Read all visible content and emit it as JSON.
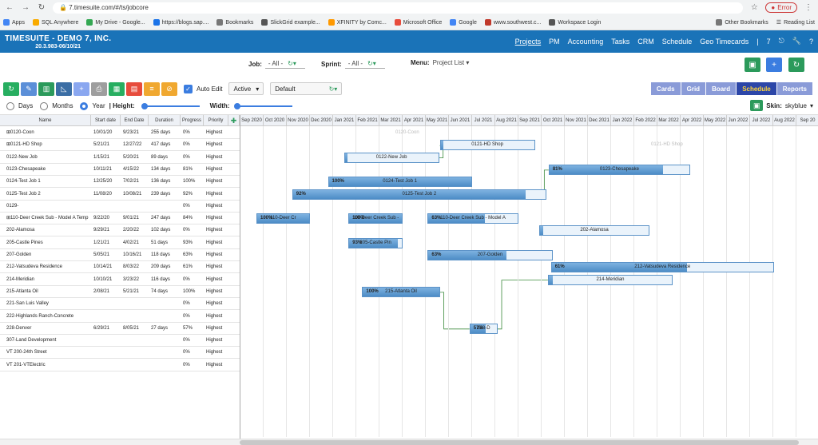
{
  "browser": {
    "url": "7.timesuite.com/#/ts/jobcore",
    "error_label": "Error",
    "bookmarks": [
      "Apps",
      "SQL Anywhere",
      "My Drive - Google...",
      "https://blogs.sap....",
      "Bookmarks",
      "SlickGrid example...",
      "XFINITY by Comc...",
      "Microsoft Office",
      "Google",
      "www.southwest.c...",
      "Workspace Login"
    ],
    "other_bookmarks": "Other Bookmarks",
    "reading_list": "Reading List"
  },
  "app": {
    "title": "TIMESUITE - DEMO 7, INC.",
    "version": "20.3.983-06/10/21",
    "menu": [
      "Projects",
      "PM",
      "Accounting",
      "Tasks",
      "CRM",
      "Schedule",
      "Geo Timecards"
    ],
    "menu_count": "7"
  },
  "filters": {
    "job_label": "Job:",
    "job_value": "- All -",
    "sprint_label": "Sprint:",
    "sprint_value": "- All -",
    "menu_label": "Menu:",
    "menu_value": "Project List"
  },
  "toolbar": {
    "auto_edit": "Auto Edit",
    "status": "Active",
    "view": "Default",
    "views": [
      "Cards",
      "Grid",
      "Board",
      "Schedule",
      "Reports"
    ],
    "active_view": "Schedule"
  },
  "scale": {
    "days": "Days",
    "months": "Months",
    "year": "Year",
    "height": "| Height:",
    "width": "Width:",
    "skin_label": "Skin:",
    "skin_value": "skyblue"
  },
  "columns": [
    "Name",
    "Start date",
    "End Date",
    "Duration",
    "Progress",
    "Priority"
  ],
  "months": [
    "Sep 2020",
    "Oct 2020",
    "Nov 2020",
    "Dec 2020",
    "Jan 2021",
    "Feb 2021",
    "Mar 2021",
    "Apr 2021",
    "May 2021",
    "Jun 2021",
    "Jul 2021",
    "Aug 2021",
    "Sep 2021",
    "Oct 2021",
    "Nov 2021",
    "Dec 2021",
    "Jan 2022",
    "Feb 2022",
    "Mar 2022",
    "Apr 2022",
    "May 2022",
    "Jun 2022",
    "Jul 2022",
    "Aug 2022",
    "Sep 20"
  ],
  "rows": [
    {
      "name": "⊞0120-Coon",
      "start": "10/01/20",
      "end": "9/23/21",
      "dur": "255 days",
      "prog": "0%",
      "pri": "Highest"
    },
    {
      "name": "⊞0121-HD Shop",
      "start": "5/21/21",
      "end": "12/27/22",
      "dur": "417 days",
      "prog": "0%",
      "pri": "Highest"
    },
    {
      "name": "0122-New Job",
      "start": "1/15/21",
      "end": "5/20/21",
      "dur": "89 days",
      "prog": "0%",
      "pri": "Highest"
    },
    {
      "name": "0123-Chesapeake",
      "start": "10/11/21",
      "end": "4/15/22",
      "dur": "134 days",
      "prog": "81%",
      "pri": "Highest"
    },
    {
      "name": "0124-Test Job 1",
      "start": "12/25/20",
      "end": "7/02/21",
      "dur": "136 days",
      "prog": "100%",
      "pri": "Highest"
    },
    {
      "name": "0125-Test Job 2",
      "start": "11/08/20",
      "end": "10/08/21",
      "dur": "239 days",
      "prog": "92%",
      "pri": "Highest"
    },
    {
      "name": "0129-",
      "start": "",
      "end": "",
      "dur": "",
      "prog": "0%",
      "pri": "Highest"
    },
    {
      "name": "⊞110-Deer Creek Sub - Model A Temp",
      "start": "9/22/20",
      "end": "9/01/21",
      "dur": "247 days",
      "prog": "84%",
      "pri": "Highest"
    },
    {
      "name": "202-Alamosa",
      "start": "9/29/21",
      "end": "2/20/22",
      "dur": "102 days",
      "prog": "0%",
      "pri": "Highest"
    },
    {
      "name": "205-Castle Pines",
      "start": "1/21/21",
      "end": "4/02/21",
      "dur": "51 days",
      "prog": "93%",
      "pri": "Highest"
    },
    {
      "name": "207-Golden",
      "start": "5/05/21",
      "end": "10/16/21",
      "dur": "118 days",
      "prog": "63%",
      "pri": "Highest"
    },
    {
      "name": "212-Vatsudeva Residence",
      "start": "10/14/21",
      "end": "8/03/22",
      "dur": "209 days",
      "prog": "61%",
      "pri": "Highest"
    },
    {
      "name": "214-Meridian",
      "start": "10/10/21",
      "end": "3/23/22",
      "dur": "116 days",
      "prog": "0%",
      "pri": "Highest"
    },
    {
      "name": "215-Atlanta Oil",
      "start": "2/08/21",
      "end": "5/21/21",
      "dur": "74 days",
      "prog": "100%",
      "pri": "Highest"
    },
    {
      "name": "221-San Luis Valley",
      "start": "",
      "end": "",
      "dur": "",
      "prog": "0%",
      "pri": "Highest"
    },
    {
      "name": "222-Highlands Ranch-Concrete",
      "start": "",
      "end": "",
      "dur": "",
      "prog": "0%",
      "pri": "Highest"
    },
    {
      "name": "228-Denver",
      "start": "6/29/21",
      "end": "8/05/21",
      "dur": "27 days",
      "prog": "57%",
      "pri": "Highest"
    },
    {
      "name": "307-Land Development",
      "start": "",
      "end": "",
      "dur": "",
      "prog": "0%",
      "pri": "Highest"
    },
    {
      "name": "VT 200-24th Street",
      "start": "",
      "end": "",
      "dur": "",
      "prog": "0%",
      "pri": "Highest"
    },
    {
      "name": "VT 201-VTElectric",
      "start": "",
      "end": "",
      "dur": "",
      "prog": "0%",
      "pri": "Highest"
    }
  ],
  "bars": [
    {
      "row": 1,
      "start": "2021-05-21",
      "end": "2021-09-23",
      "label": "0121-HD Shop",
      "pct": ""
    },
    {
      "row": 2,
      "start": "2021-01-15",
      "end": "2021-05-20",
      "label": "0122-New Job",
      "pct": ""
    },
    {
      "row": 3,
      "start": "2021-10-11",
      "end": "2022-04-15",
      "label": "0123-Chesapeake",
      "pct": "81%",
      "progress": 0.81
    },
    {
      "row": 4,
      "start": "2020-12-25",
      "end": "2021-07-02",
      "label": "0124-Test Job 1",
      "pct": "100%",
      "progress": 1
    },
    {
      "row": 5,
      "start": "2020-11-08",
      "end": "2021-10-08",
      "label": "0125-Test Job 2",
      "pct": "92%",
      "progress": 0.92
    },
    {
      "row": 7,
      "start": "2020-09-22",
      "end": "2020-12-01",
      "label": "110-Deer Cr",
      "pct": "100%",
      "progress": 1
    },
    {
      "row": 7,
      "start": "2021-01-21",
      "end": "2021-04-02",
      "label": "110-Deer Creek Sub -",
      "pct": "100%",
      "progress": 1
    },
    {
      "row": 7,
      "start": "2021-05-05",
      "end": "2021-09-01",
      "label": "110-Deer Creek Sub - Model A",
      "pct": "63%",
      "progress": 0.63
    },
    {
      "row": 8,
      "start": "2021-09-29",
      "end": "2022-02-20",
      "label": "202-Alamosa",
      "pct": ""
    },
    {
      "row": 9,
      "start": "2021-01-21",
      "end": "2021-04-02",
      "label": "205-Castle Pin",
      "pct": "93%",
      "progress": 0.93
    },
    {
      "row": 10,
      "start": "2021-05-05",
      "end": "2021-10-16",
      "label": "207-Golden",
      "pct": "63%",
      "progress": 0.63
    },
    {
      "row": 11,
      "start": "2021-10-14",
      "end": "2022-08-03",
      "label": "212-Vatsudeva Residence",
      "pct": "61%",
      "progress": 0.61
    },
    {
      "row": 12,
      "start": "2021-10-10",
      "end": "2022-03-23",
      "label": "214-Meridian",
      "pct": ""
    },
    {
      "row": 13,
      "start": "2021-02-08",
      "end": "2021-05-21",
      "label": "215-Atlanta Oil",
      "pct": "100%",
      "progress": 1
    },
    {
      "row": 16,
      "start": "2021-06-29",
      "end": "2021-08-05",
      "label": "228-D",
      "pct": "57%",
      "progress": 0.57
    }
  ],
  "ghosts": [
    {
      "row": 0,
      "text": "0120-Coon"
    },
    {
      "row": 1,
      "text": "0121-HD Shop"
    }
  ]
}
